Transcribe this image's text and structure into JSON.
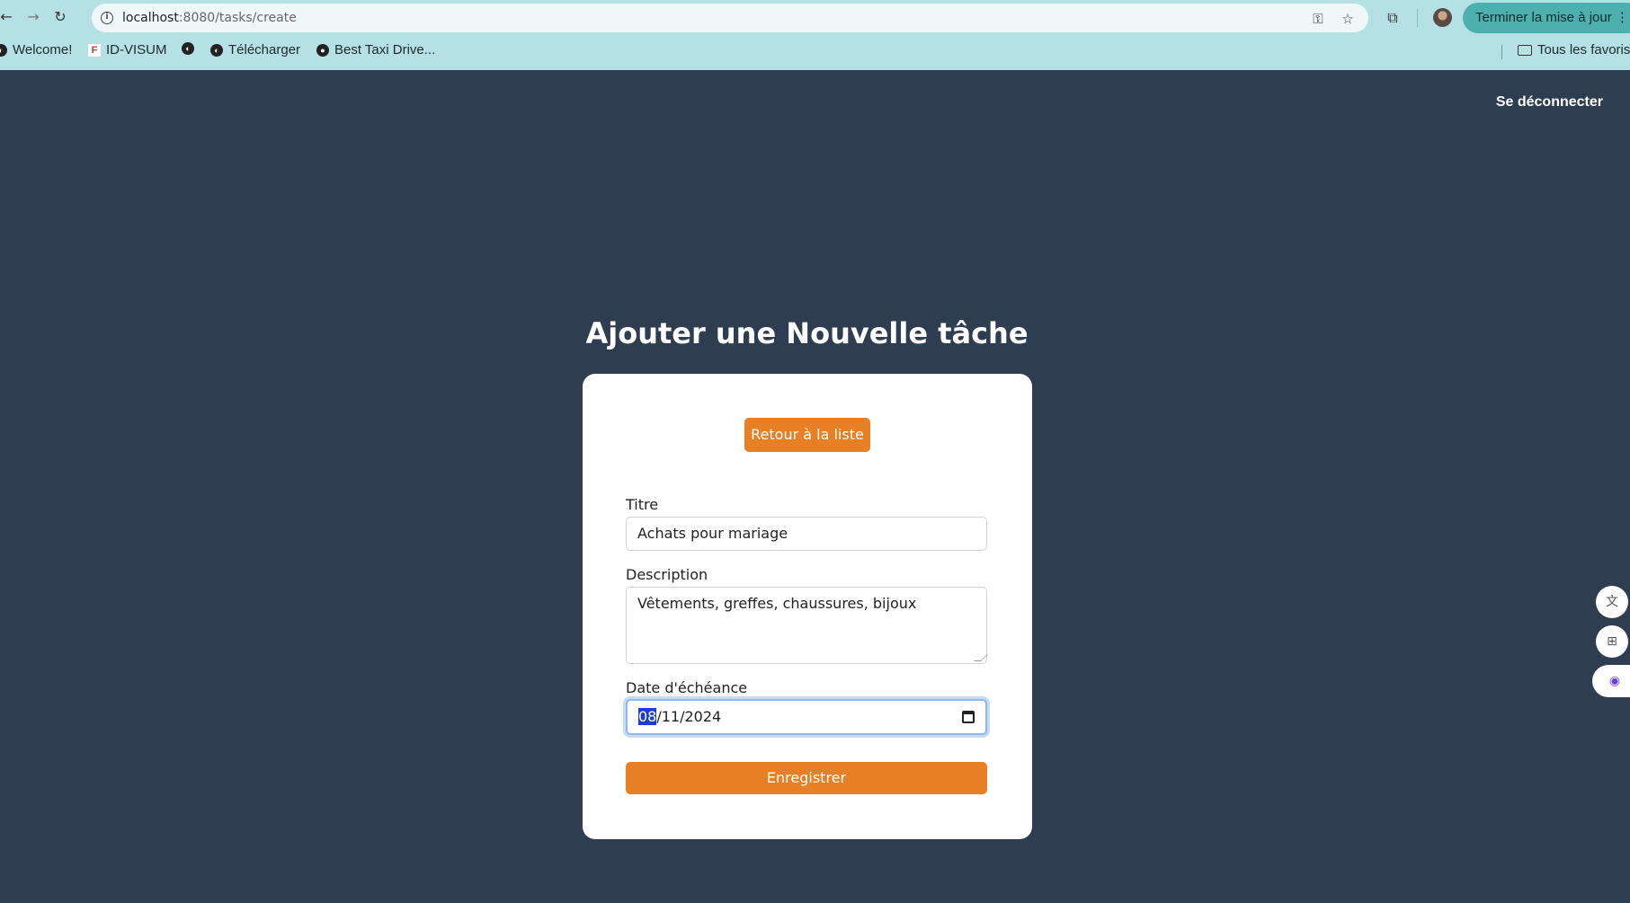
{
  "browser": {
    "url_host": "localhost",
    "url_rest": ":8080/tasks/create",
    "update_label": "Terminer la mise à jour",
    "bookmarks": [
      "Welcome!",
      "ID-VISUM",
      "Télécharger",
      "Best Taxi Drive...",
      "Tous les favoris"
    ]
  },
  "header": {
    "logout_label": "Se déconnecter"
  },
  "page": {
    "title": "Ajouter une Nouvelle tâche",
    "back_label": "Retour à la liste"
  },
  "form": {
    "title_label": "Titre",
    "title_value": "Achats pour mariage",
    "description_label": "Description",
    "description_value": "Vêtements, greffes, chaussures, bijoux",
    "due_label": "Date d'échéance",
    "due_day": "08",
    "due_rest": "/11/2024",
    "save_label": "Enregistrer"
  },
  "icons": {
    "side_tools": [
      "translate-icon",
      "apps-icon",
      "assistant-icon"
    ]
  }
}
